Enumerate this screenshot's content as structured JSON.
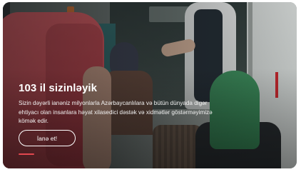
{
  "hero": {
    "title": "103 il sizinləyik",
    "description": "Sizin dəyərli ianəniz milyonlarla Azərbaycanlılara və bütün dünyada digər ehtiyacı olan insanlara həyat xilasedici dəstək və xidmətlər göstərməyimizə kömək edir.",
    "button_label": "İanə et!",
    "accent_color": "#e2474f"
  }
}
